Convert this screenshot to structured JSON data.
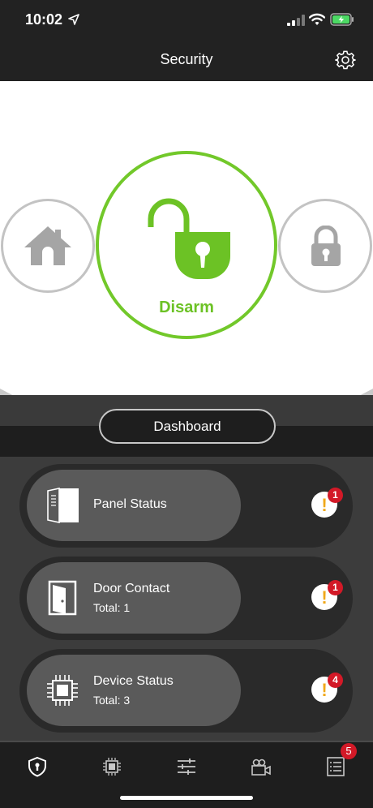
{
  "status_bar": {
    "time": "10:02"
  },
  "header": {
    "title": "Security"
  },
  "arm_modes": {
    "active_label": "Disarm",
    "accent_color": "#6cc225"
  },
  "dashboard": {
    "label": "Dashboard"
  },
  "cards": [
    {
      "title": "Panel Status",
      "subtitle": "",
      "alert_count": "1",
      "icon": "panel-icon"
    },
    {
      "title": "Door Contact",
      "subtitle": "Total: 1",
      "alert_count": "1",
      "icon": "door-icon"
    },
    {
      "title": "Device Status",
      "subtitle": "Total: 3",
      "alert_count": "4",
      "icon": "chip-icon"
    }
  ],
  "tabbar": {
    "history_badge": "5"
  },
  "colors": {
    "alert_badge": "#d31927",
    "warning": "#f0a81a"
  }
}
